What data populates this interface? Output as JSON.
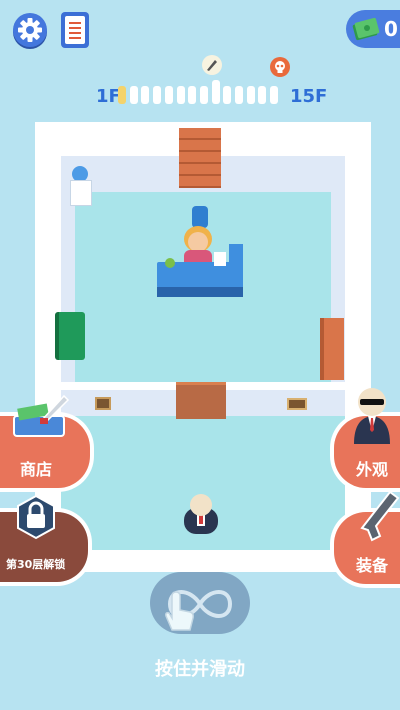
{
  "top": {
    "cash_count": "0"
  },
  "progress": {
    "start_floor": "1F",
    "end_floor": "15F",
    "segments_total": 14,
    "segments_active": 1
  },
  "buttons": {
    "shop_label": "商店",
    "skin_label": "外观",
    "equip_label": "装备",
    "locked_label": "第30层解锁"
  },
  "hint": {
    "text": "按住并滑动"
  },
  "icons": [
    "settings-icon",
    "notes-icon",
    "cash-icon",
    "knife-icon",
    "skull-icon",
    "infinity-icon",
    "hand-icon",
    "lock-icon",
    "pistol-icon"
  ],
  "colors": {
    "accent": "#4477dd",
    "button": "#e8745a",
    "floor": "#a9e4ea",
    "progress": "#f4d36b"
  }
}
